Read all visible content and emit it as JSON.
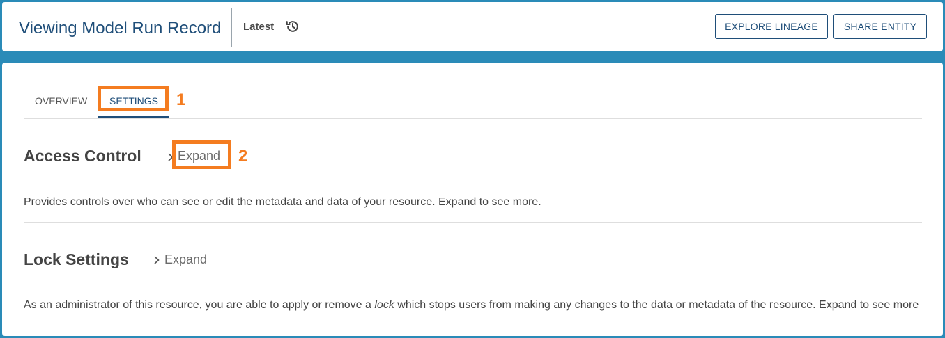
{
  "header": {
    "title": "Viewing Model Run Record",
    "version_label": "Latest",
    "version_icon": "history-icon",
    "buttons": {
      "explore_lineage": "EXPLORE LINEAGE",
      "share_entity": "SHARE ENTITY"
    }
  },
  "tabs": [
    {
      "label": "OVERVIEW",
      "active": false
    },
    {
      "label": "SETTINGS",
      "active": true
    }
  ],
  "annotations": {
    "marker_1": "1",
    "marker_2": "2",
    "highlight_color": "#f47c20"
  },
  "sections": [
    {
      "title": "Access Control",
      "expand_label": "Expand",
      "description": "Provides controls over who can see or edit the metadata and data of your resource. Expand to see more."
    },
    {
      "title": "Lock Settings",
      "expand_label": "Expand",
      "description_before": "As an administrator of this resource, you are able to apply or remove a ",
      "description_em": "lock",
      "description_after": " which stops users from making any changes to the data or metadata of the resource. Expand to see more"
    }
  ],
  "colors": {
    "brand_blue": "#1f4e79",
    "background_band": "#2a8bb8"
  }
}
